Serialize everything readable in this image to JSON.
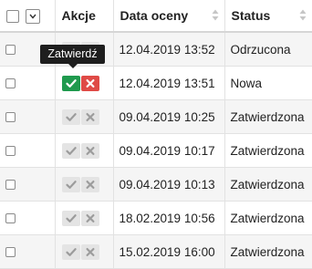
{
  "header": {
    "actions_label": "Akcje",
    "date_label": "Data oceny",
    "status_label": "Status"
  },
  "tooltip": {
    "text": "Zatwierdź"
  },
  "rows": [
    {
      "date": "12.04.2019 13:52",
      "status": "Odrzucona",
      "actions_active": false
    },
    {
      "date": "12.04.2019 13:51",
      "status": "Nowa",
      "actions_active": true
    },
    {
      "date": "09.04.2019 10:25",
      "status": "Zatwierdzona",
      "actions_active": false
    },
    {
      "date": "09.04.2019 10:17",
      "status": "Zatwierdzona",
      "actions_active": false
    },
    {
      "date": "09.04.2019 10:13",
      "status": "Zatwierdzona",
      "actions_active": false
    },
    {
      "date": "18.02.2019 10:56",
      "status": "Zatwierdzona",
      "actions_active": false
    },
    {
      "date": "15.02.2019 16:00",
      "status": "Zatwierdzona",
      "actions_active": false
    }
  ],
  "colors": {
    "approve_active": "#1f9a4e",
    "reject_active": "#df4a46",
    "action_inactive": "#e4e4e4",
    "row_stripe": "#f5f5f5"
  },
  "icons": {
    "approve": "check-icon",
    "reject": "close-icon",
    "sort": "sort-icon",
    "menu": "chevron-down-icon"
  }
}
